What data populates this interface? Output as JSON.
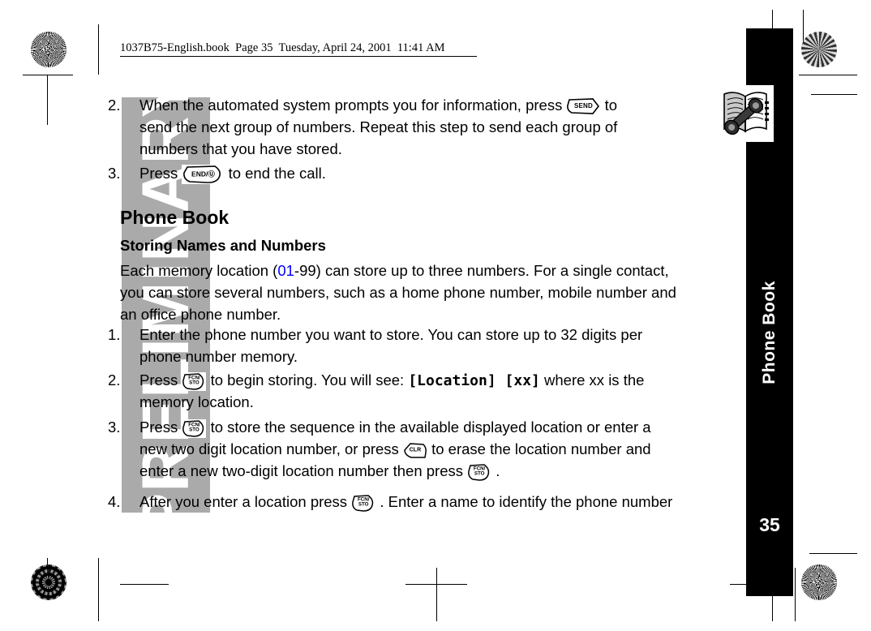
{
  "document": {
    "header_line": "1037B75-English.book  Page 35  Tuesday, April 24, 2001  11:41 AM",
    "watermark": "PRELIMINARY",
    "page_number": "35",
    "tab_title": "Phone Book",
    "accent_blue": "#0000ff",
    "watermark_gray": "#aaaaaa",
    "tab_black": "#000000"
  },
  "icons": {
    "phonebook": "phonebook-icon",
    "key_send": "SEND",
    "key_end_line1": "END/",
    "key_end_line2": "",
    "key_end": "END/Ⓤ",
    "key_fcn_line1": "FCN/",
    "key_fcn_line2": "STO",
    "key_clr": "CLR"
  },
  "body": {
    "step2_top": {
      "number": "2.",
      "line1_a": "When the automated system prompts you for information, press",
      "line1_b": "to",
      "line2": "send the next group of numbers. Repeat this step to send each group of",
      "line3": "numbers that you have stored."
    },
    "step3_top": {
      "number": "3.",
      "line1_a": "Press",
      "line1_b": "to end the call."
    },
    "heading": "Phone Book",
    "subheading": "Storing Names and Numbers",
    "intro": {
      "line1_a": "Each memory location (",
      "line1_blue": "01",
      "line1_b": "-99) can store up to three numbers. For a single contact,",
      "line2": "you can store several numbers, such as a home phone number, mobile number and",
      "line3": "an office phone number."
    },
    "steps": [
      {
        "number": "1.",
        "line1": "Enter the phone number you want to store. You can store up to 32 digits per",
        "line2": "phone number memory."
      },
      {
        "number": "2.",
        "line1_a": "Press",
        "line1_b": "to begin storing. You will see:",
        "line1_lcd": "[Location] [xx]",
        "line1_c": "where xx is the",
        "line2": "memory location."
      },
      {
        "number": "3.",
        "line1_a": "Press",
        "line1_b": "to store the sequence in the available displayed location or enter a",
        "line2_a": "new two digit location number, or press",
        "line2_b": "to erase the location number and",
        "line3_a": "enter a new two-digit location number then press",
        "line3_b": "."
      },
      {
        "number": "4.",
        "line1_a": "After you enter a location press",
        "line1_b": ". Enter a name to identify the phone number"
      }
    ]
  }
}
